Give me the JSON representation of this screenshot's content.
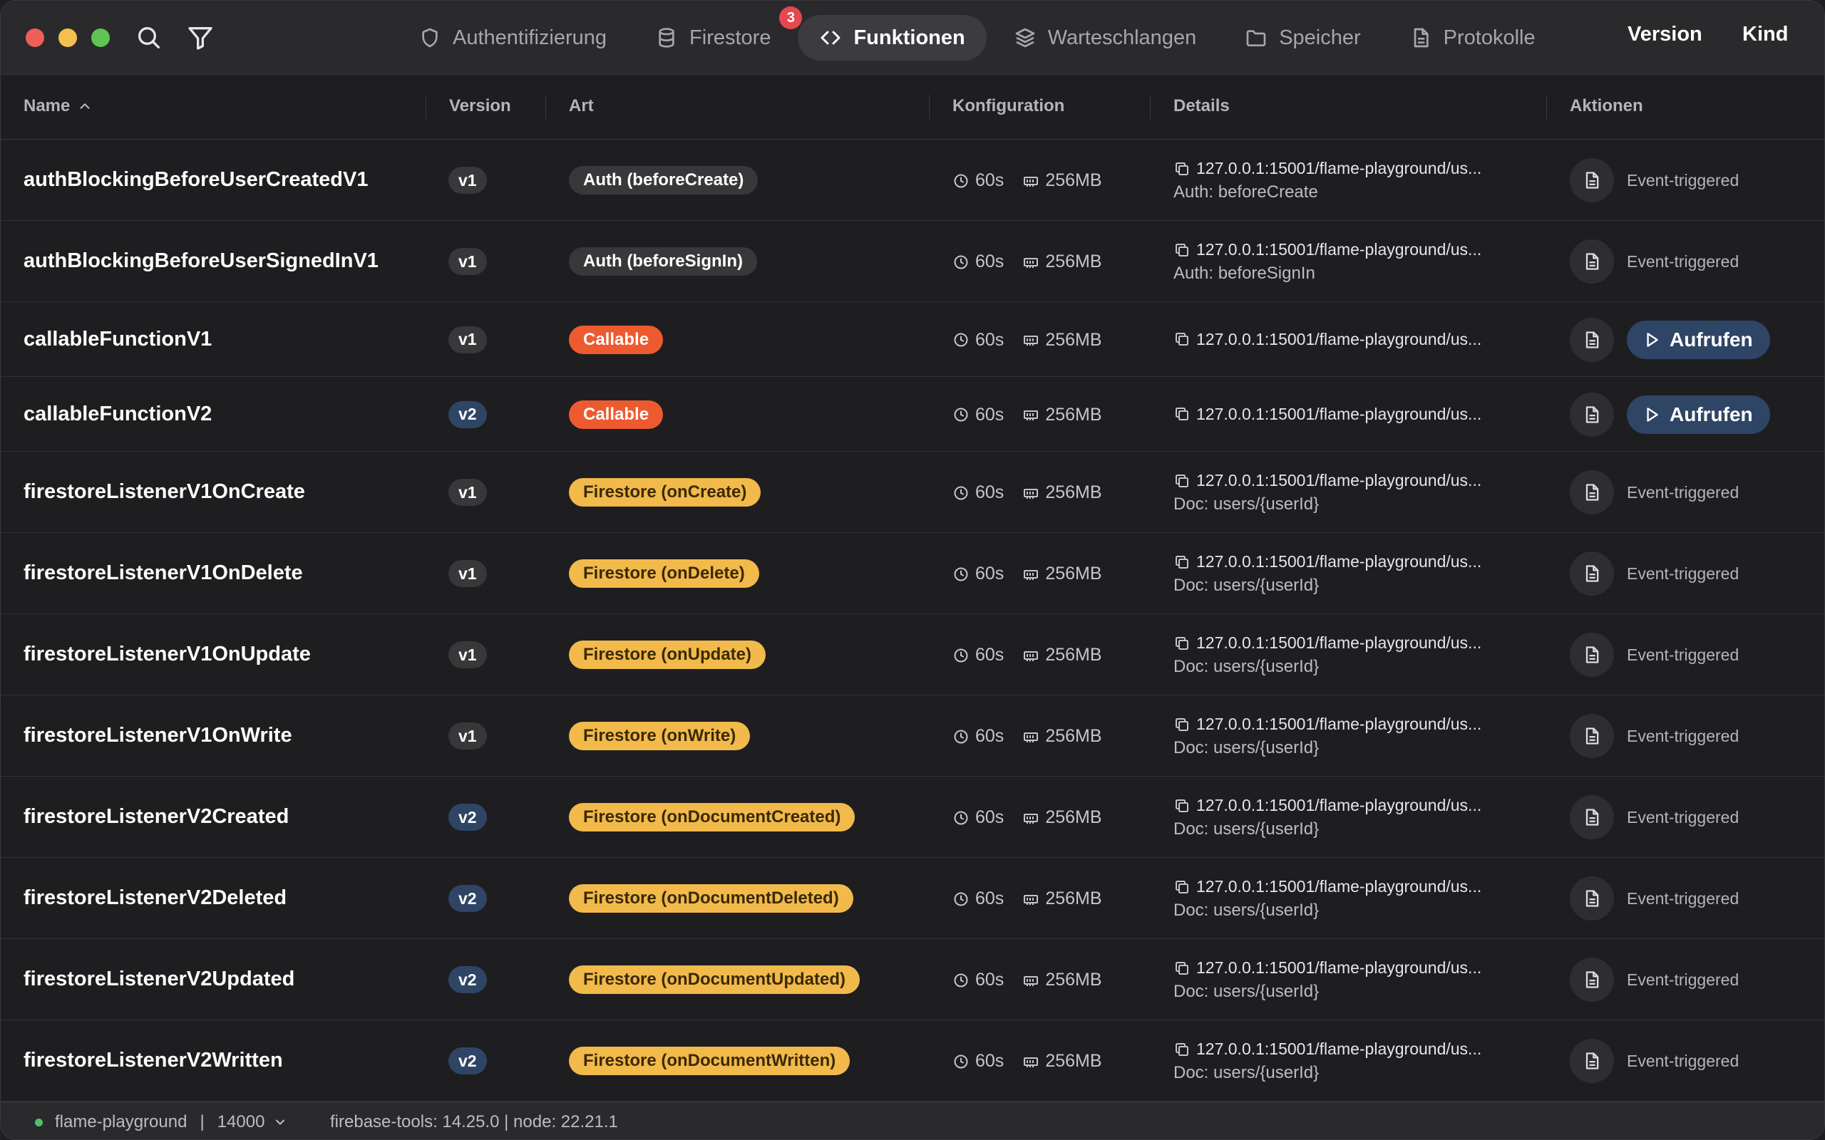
{
  "toolbar": {
    "tabs": [
      {
        "label": "Authentifizierung",
        "icon": "shield-icon"
      },
      {
        "label": "Firestore",
        "icon": "database-icon",
        "badge": "3"
      },
      {
        "label": "Funktionen",
        "icon": "code-icon",
        "active": true
      },
      {
        "label": "Warteschlangen",
        "icon": "layers-icon"
      },
      {
        "label": "Speicher",
        "icon": "folder-icon"
      },
      {
        "label": "Protokolle",
        "icon": "document-icon"
      }
    ],
    "right": {
      "version_label": "Version",
      "kind_label": "Kind"
    }
  },
  "table": {
    "columns": {
      "name": "Name",
      "version": "Version",
      "kind": "Art",
      "config": "Konfiguration",
      "details": "Details",
      "actions": "Aktionen"
    },
    "rows": [
      {
        "name": "authBlockingBeforeUserCreatedV1",
        "version": "v1",
        "kind": "Auth (beforeCreate)",
        "kind_style": "auth",
        "timeout": "60s",
        "memory": "256MB",
        "url": "127.0.0.1:15001/flame-playground/us...",
        "sub": "Auth: beforeCreate",
        "action": "Event-triggered"
      },
      {
        "name": "authBlockingBeforeUserSignedInV1",
        "version": "v1",
        "kind": "Auth (beforeSignIn)",
        "kind_style": "auth",
        "timeout": "60s",
        "memory": "256MB",
        "url": "127.0.0.1:15001/flame-playground/us...",
        "sub": "Auth: beforeSignIn",
        "action": "Event-triggered"
      },
      {
        "name": "callableFunctionV1",
        "version": "v1",
        "kind": "Callable",
        "kind_style": "callable",
        "timeout": "60s",
        "memory": "256MB",
        "url": "127.0.0.1:15001/flame-playground/us...",
        "sub": "",
        "action": "Aufrufen"
      },
      {
        "name": "callableFunctionV2",
        "version": "v2",
        "kind": "Callable",
        "kind_style": "callable",
        "timeout": "60s",
        "memory": "256MB",
        "url": "127.0.0.1:15001/flame-playground/us...",
        "sub": "",
        "action": "Aufrufen"
      },
      {
        "name": "firestoreListenerV1OnCreate",
        "version": "v1",
        "kind": "Firestore (onCreate)",
        "kind_style": "firestore",
        "timeout": "60s",
        "memory": "256MB",
        "url": "127.0.0.1:15001/flame-playground/us...",
        "sub": "Doc: users/{userId}",
        "action": "Event-triggered"
      },
      {
        "name": "firestoreListenerV1OnDelete",
        "version": "v1",
        "kind": "Firestore (onDelete)",
        "kind_style": "firestore",
        "timeout": "60s",
        "memory": "256MB",
        "url": "127.0.0.1:15001/flame-playground/us...",
        "sub": "Doc: users/{userId}",
        "action": "Event-triggered"
      },
      {
        "name": "firestoreListenerV1OnUpdate",
        "version": "v1",
        "kind": "Firestore (onUpdate)",
        "kind_style": "firestore",
        "timeout": "60s",
        "memory": "256MB",
        "url": "127.0.0.1:15001/flame-playground/us...",
        "sub": "Doc: users/{userId}",
        "action": "Event-triggered"
      },
      {
        "name": "firestoreListenerV1OnWrite",
        "version": "v1",
        "kind": "Firestore (onWrite)",
        "kind_style": "firestore",
        "timeout": "60s",
        "memory": "256MB",
        "url": "127.0.0.1:15001/flame-playground/us...",
        "sub": "Doc: users/{userId}",
        "action": "Event-triggered"
      },
      {
        "name": "firestoreListenerV2Created",
        "version": "v2",
        "kind": "Firestore (onDocumentCreated)",
        "kind_style": "firestore",
        "timeout": "60s",
        "memory": "256MB",
        "url": "127.0.0.1:15001/flame-playground/us...",
        "sub": "Doc: users/{userId}",
        "action": "Event-triggered"
      },
      {
        "name": "firestoreListenerV2Deleted",
        "version": "v2",
        "kind": "Firestore (onDocumentDeleted)",
        "kind_style": "firestore",
        "timeout": "60s",
        "memory": "256MB",
        "url": "127.0.0.1:15001/flame-playground/us...",
        "sub": "Doc: users/{userId}",
        "action": "Event-triggered"
      },
      {
        "name": "firestoreListenerV2Updated",
        "version": "v2",
        "kind": "Firestore (onDocumentUpdated)",
        "kind_style": "firestore",
        "timeout": "60s",
        "memory": "256MB",
        "url": "127.0.0.1:15001/flame-playground/us...",
        "sub": "Doc: users/{userId}",
        "action": "Event-triggered"
      },
      {
        "name": "firestoreListenerV2Written",
        "version": "v2",
        "kind": "Firestore (onDocumentWritten)",
        "kind_style": "firestore",
        "timeout": "60s",
        "memory": "256MB",
        "url": "127.0.0.1:15001/flame-playground/us...",
        "sub": "Doc: users/{userId}",
        "action": "Event-triggered"
      }
    ]
  },
  "statusbar": {
    "project": "flame-playground",
    "separator": "|",
    "port": "14000",
    "tools": "firebase-tools: 14.25.0 | node: 22.21.1",
    "status_color": "#4cc26a"
  },
  "colors": {
    "callable": "#ee5a2f",
    "firestore": "#f2b94b",
    "v2_badge": "#2f4566",
    "badge_red": "#e5484d"
  }
}
